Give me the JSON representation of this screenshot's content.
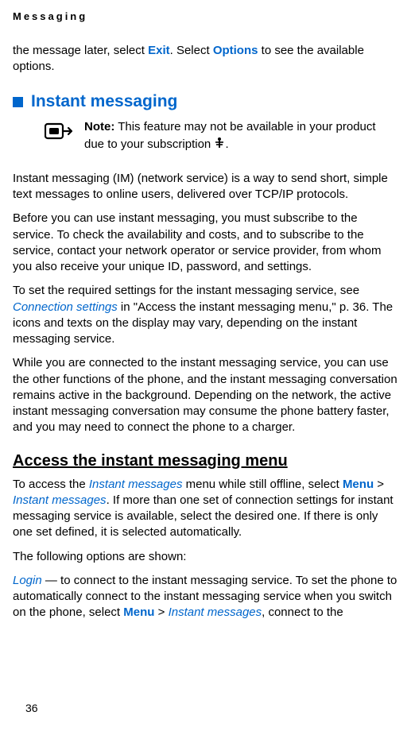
{
  "header": {
    "section": "Messaging"
  },
  "intro": {
    "prefix": "the message later, select ",
    "exit": "Exit",
    "mid": ". Select ",
    "options": "Options",
    "suffix": " to see the available options."
  },
  "heading1": "Instant messaging",
  "note": {
    "label": "Note:",
    "text": " This feature may not be available in your product due to your subscription ",
    "tail": "."
  },
  "para1": "Instant messaging (IM) (network service) is a way to send short, simple text messages to online users, delivered over TCP/IP protocols.",
  "para2": "Before you can use instant messaging, you must subscribe to the service. To check the availability and costs, and to subscribe to the service, contact your network operator or service provider, from whom you also receive your unique ID, password, and settings.",
  "para3": {
    "prefix": "To set the required settings for the instant messaging service, see ",
    "link": "Connection settings",
    "suffix": " in \"Access the instant messaging menu,\" p. 36. The icons and texts on the display may vary, depending on the instant messaging service."
  },
  "para4": "While you are connected to the instant messaging service, you can use the other functions of the phone, and the instant messaging conversation remains active in the background. Depending on the network, the active instant messaging conversation may consume the phone battery faster, and you may need to connect the phone to a charger.",
  "subheading": "Access the instant messaging menu",
  "para5": {
    "prefix": "To access the ",
    "link1": "Instant messages",
    "mid1": " menu while still offline, select ",
    "menu": "Menu",
    "gt": " > ",
    "link2": "Instant messages",
    "suffix": ". If more than one set of connection settings for instant messaging service is available, select the desired one. If there is only one set defined, it is selected automatically."
  },
  "para6": "The following options are shown:",
  "para7": {
    "login": "Login",
    "mid1": " — to connect to the instant messaging service. To set the phone to automatically connect to the instant messaging service when you switch on the phone, select ",
    "menu": "Menu",
    "gt": " > ",
    "link": "Instant messages",
    "suffix": ", connect to the"
  },
  "pageNumber": "36"
}
